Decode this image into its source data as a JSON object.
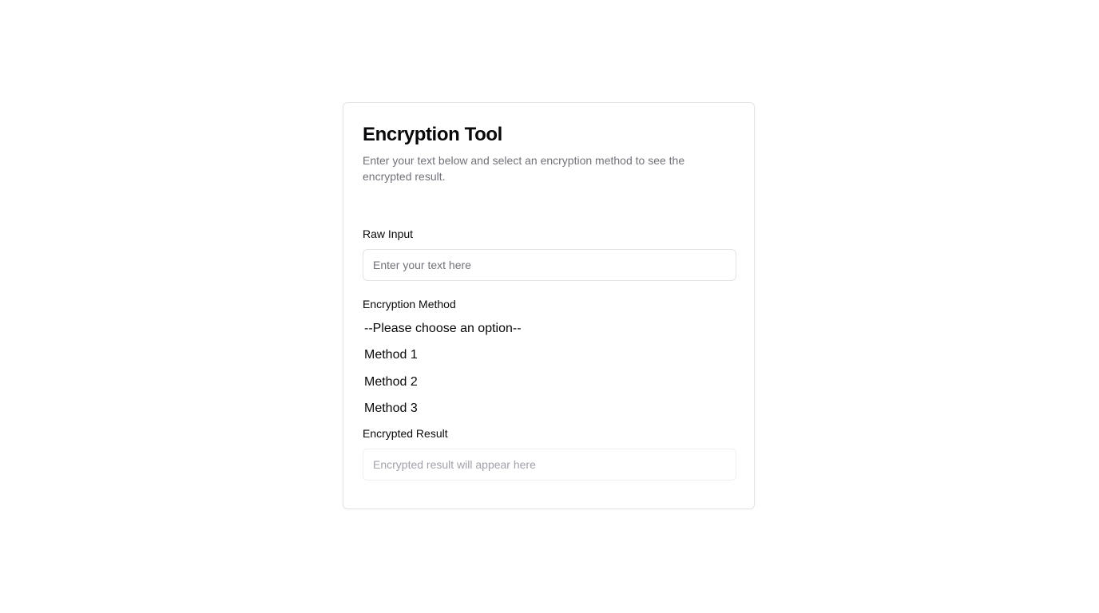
{
  "card": {
    "title": "Encryption Tool",
    "description": "Enter your text below and select an encryption method to see the encrypted result."
  },
  "raw_input": {
    "label": "Raw Input",
    "placeholder": "Enter your text here",
    "value": ""
  },
  "encryption_method": {
    "label": "Encryption Method",
    "options": [
      "--Please choose an option--",
      "Method 1",
      "Method 2",
      "Method 3"
    ]
  },
  "encrypted_result": {
    "label": "Encrypted Result",
    "placeholder": "Encrypted result will appear here",
    "value": ""
  },
  "colors": {
    "text": "#09090b",
    "muted": "#71717a",
    "border": "#e4e4e7",
    "placeholder_disabled": "#a1a1aa"
  }
}
